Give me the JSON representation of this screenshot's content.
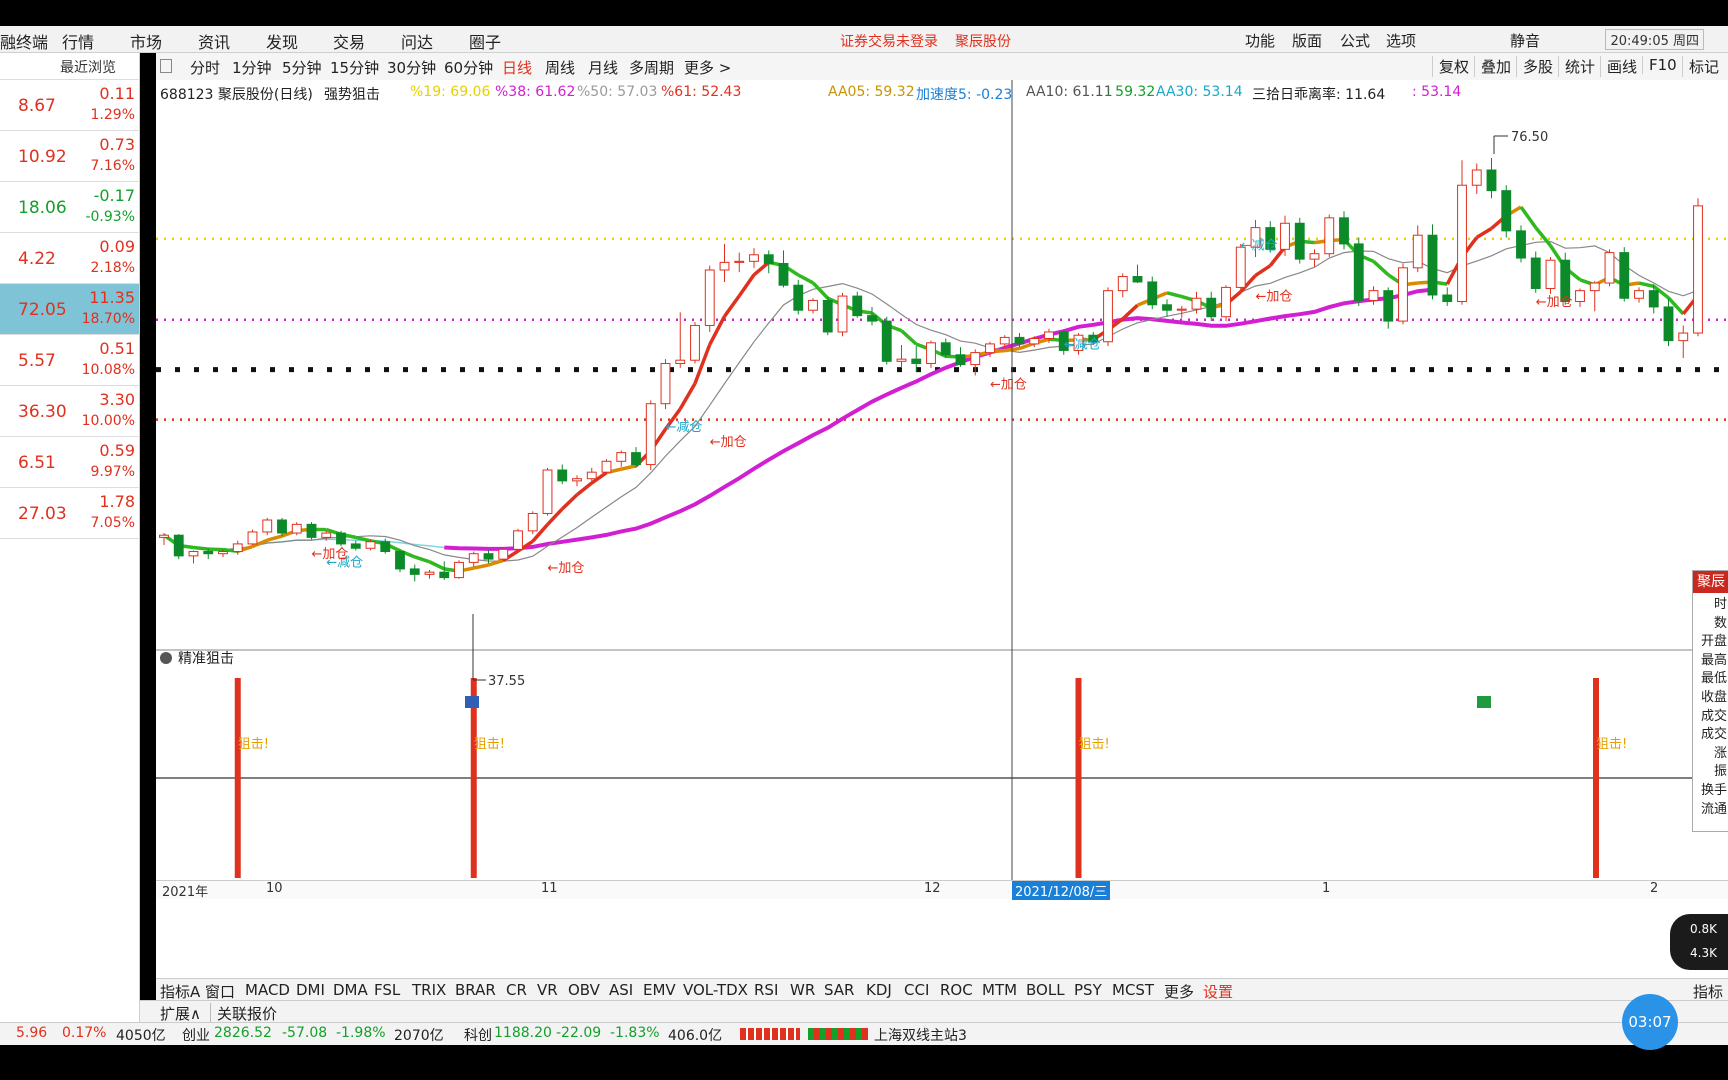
{
  "menu": {
    "items": [
      "融终端",
      "行情",
      "市场",
      "资讯",
      "发现",
      "交易",
      "问达",
      "圈子"
    ],
    "notice": "证券交易未登录",
    "stock_link": "聚辰股份",
    "right_items": [
      "功能",
      "版面",
      "公式",
      "选项",
      "",
      "静音"
    ],
    "time": "20:49:05 周四"
  },
  "left_panel": {
    "header": "最近浏览",
    "rows": [
      {
        "price": "8.67",
        "change": "0.11",
        "pct": "1.29%",
        "dir": "up"
      },
      {
        "price": "10.92",
        "change": "0.73",
        "pct": "7.16%",
        "dir": "up"
      },
      {
        "price": "18.06",
        "change": "-0.17",
        "pct": "-0.93%",
        "dir": "down"
      },
      {
        "price": "4.22",
        "change": "0.09",
        "pct": "2.18%",
        "dir": "up"
      },
      {
        "price": "72.05",
        "change": "11.35",
        "pct": "18.70%",
        "dir": "up",
        "selected": true
      },
      {
        "price": "5.57",
        "change": "0.51",
        "pct": "10.08%",
        "dir": "up"
      },
      {
        "price": "36.30",
        "change": "3.30",
        "pct": "10.00%",
        "dir": "up"
      },
      {
        "price": "6.51",
        "change": "0.59",
        "pct": "9.97%",
        "dir": "up"
      },
      {
        "price": "27.03",
        "change": "1.78",
        "pct": "7.05%",
        "dir": "up"
      }
    ]
  },
  "toolbar": {
    "periods": [
      "分时",
      "1分钟",
      "5分钟",
      "15分钟",
      "30分钟",
      "60分钟",
      "日线",
      "周线",
      "月线",
      "多周期",
      "更多 >"
    ],
    "active_period": "日线",
    "right_buttons": [
      "复权",
      "叠加",
      "多股",
      "统计",
      "画线",
      "F10",
      "标记"
    ]
  },
  "chart_header": {
    "title": "688123 聚辰股份(日线)",
    "formula": "强势狙击",
    "p19": "%19: 69.06",
    "p38": "%38: 61.62",
    "p50": "%50: 57.03",
    "p61": "%61: 52.43",
    "aa05": "AA05: 59.32",
    "accel": "加速度5: -0.23",
    "aa10": "AA10: 61.11",
    "v2": ": 59.32",
    "aa30": "AA30: 53.14",
    "dev": "三拾日乖离率: 11.64",
    "dev2": ": 53.14",
    "high_label": "76.50",
    "low_label": "37.55"
  },
  "signals": {
    "add": "加仓",
    "reduce": "减仓",
    "snipe": "狙击!"
  },
  "lower_panel": {
    "title": "精准狙击"
  },
  "date_axis": {
    "year": "2021年",
    "m10": "10",
    "m11": "11",
    "m12": "12",
    "m1": "1",
    "m2": "2",
    "cursor": "2021/12/08/三"
  },
  "tabs": [
    "指标A",
    "窗口",
    "MACD",
    "DMI",
    "DMA",
    "FSL",
    "TRIX",
    "BRAR",
    "CR",
    "VR",
    "OBV",
    "ASI",
    "EMV",
    "VOL-TDX",
    "RSI",
    "WR",
    "SAR",
    "KDJ",
    "CCI",
    "ROC",
    "MTM",
    "BOLL",
    "PSY",
    "MCST",
    "更多",
    "设置"
  ],
  "tab_right": "指标B",
  "expand": {
    "label": "扩展∧",
    "link": "关联报价"
  },
  "status": {
    "a": "5.96",
    "b": "0.17%",
    "c": "4050亿",
    "cy_label": "创业",
    "cy": "2826.52",
    "cy_chg": "-57.08",
    "cy_pct": "-1.98%",
    "cy_amt": "2070亿",
    "kc_label": "科创",
    "kc": "1188.20",
    "kc_chg": "-22.09",
    "kc_pct": "-1.83%",
    "kc_amt": "406.0亿",
    "server": "上海双线主站3"
  },
  "right_panel": {
    "title": "聚辰",
    "items": [
      "时",
      "数",
      "开盘",
      "最高",
      "最低",
      "收盘",
      "成交",
      "成交",
      "涨",
      "振",
      "换手",
      "流通"
    ]
  },
  "timer": "03:07",
  "speed": {
    "up": "0.8K",
    "down": "4.3K"
  },
  "chart_data": {
    "type": "candlestick",
    "title": "688123 聚辰股份(日线)",
    "period": "2021-09 to 2022-02",
    "high": 76.5,
    "low": 37.55,
    "hlines": [
      69.06,
      61.62,
      57.03,
      52.43
    ],
    "candles": [
      [
        41.6,
        42.0,
        40.9,
        41.8
      ],
      [
        41.8,
        41.9,
        39.6,
        39.9
      ],
      [
        39.9,
        40.4,
        39.2,
        40.3
      ],
      [
        40.3,
        40.6,
        39.6,
        40.1
      ],
      [
        40.1,
        40.5,
        39.8,
        40.3
      ],
      [
        40.3,
        41.3,
        40.0,
        41.0
      ],
      [
        41.0,
        42.3,
        40.9,
        42.1
      ],
      [
        42.1,
        43.4,
        41.8,
        43.2
      ],
      [
        43.2,
        43.4,
        41.7,
        42.0
      ],
      [
        42.0,
        43.0,
        41.8,
        42.8
      ],
      [
        42.8,
        43.0,
        41.4,
        41.6
      ],
      [
        41.6,
        42.2,
        41.3,
        42.0
      ],
      [
        42.0,
        42.2,
        40.8,
        41.0
      ],
      [
        41.0,
        41.3,
        40.4,
        40.6
      ],
      [
        40.6,
        41.4,
        40.4,
        41.2
      ],
      [
        41.2,
        41.5,
        40.1,
        40.3
      ],
      [
        40.3,
        40.5,
        38.4,
        38.7
      ],
      [
        38.7,
        39.1,
        37.55,
        38.2
      ],
      [
        38.2,
        38.6,
        37.8,
        38.4
      ],
      [
        38.4,
        39.4,
        37.7,
        37.9
      ],
      [
        37.9,
        39.5,
        37.8,
        39.3
      ],
      [
        39.3,
        40.3,
        38.9,
        40.1
      ],
      [
        40.1,
        40.4,
        39.2,
        39.6
      ],
      [
        39.6,
        40.7,
        39.4,
        40.5
      ],
      [
        40.5,
        42.4,
        40.3,
        42.2
      ],
      [
        42.2,
        44.0,
        41.9,
        43.8
      ],
      [
        43.8,
        48.0,
        43.6,
        47.8
      ],
      [
        47.8,
        48.3,
        46.5,
        46.8
      ],
      [
        46.8,
        47.3,
        46.3,
        47.0
      ],
      [
        47.0,
        48.0,
        46.6,
        47.6
      ],
      [
        47.6,
        48.8,
        47.4,
        48.6
      ],
      [
        48.6,
        49.6,
        48.1,
        49.4
      ],
      [
        49.4,
        49.9,
        48.0,
        48.3
      ],
      [
        48.3,
        54.2,
        47.8,
        53.9
      ],
      [
        53.9,
        58.0,
        53.4,
        57.6
      ],
      [
        57.6,
        62.3,
        57.2,
        57.9
      ],
      [
        57.9,
        61.4,
        57.6,
        61.1
      ],
      [
        61.1,
        66.6,
        60.5,
        66.2
      ],
      [
        66.2,
        68.6,
        65.1,
        66.9
      ],
      [
        66.9,
        67.8,
        66.0,
        67.0
      ],
      [
        67.0,
        68.2,
        66.4,
        67.6
      ],
      [
        67.6,
        68.0,
        65.9,
        66.8
      ],
      [
        66.8,
        68.0,
        64.6,
        64.8
      ],
      [
        64.8,
        65.3,
        62.1,
        62.5
      ],
      [
        62.5,
        63.6,
        62.2,
        63.4
      ],
      [
        63.4,
        63.7,
        60.2,
        60.5
      ],
      [
        60.5,
        64.1,
        60.1,
        63.8
      ],
      [
        63.8,
        64.2,
        61.8,
        62.0
      ],
      [
        62.0,
        62.8,
        61.1,
        61.5
      ],
      [
        61.5,
        61.9,
        57.5,
        57.8
      ],
      [
        57.8,
        59.3,
        57.2,
        58.0
      ],
      [
        58.0,
        59.2,
        56.8,
        57.6
      ],
      [
        57.6,
        59.7,
        57.2,
        59.5
      ],
      [
        59.5,
        59.9,
        58.1,
        58.4
      ],
      [
        58.4,
        59.1,
        57.3,
        57.5
      ],
      [
        57.5,
        58.9,
        56.5,
        58.6
      ],
      [
        58.6,
        59.6,
        58.2,
        59.4
      ],
      [
        59.4,
        60.2,
        59.0,
        60.0
      ],
      [
        60.0,
        60.4,
        59.1,
        59.4
      ],
      [
        59.4,
        60.1,
        59.1,
        59.9
      ],
      [
        59.9,
        60.8,
        59.5,
        60.5
      ],
      [
        60.5,
        60.7,
        58.4,
        58.8
      ],
      [
        58.8,
        60.4,
        58.4,
        60.2
      ],
      [
        60.2,
        60.5,
        59.3,
        59.6
      ],
      [
        59.6,
        64.6,
        59.2,
        64.3
      ],
      [
        64.3,
        65.9,
        63.7,
        65.6
      ],
      [
        65.6,
        66.7,
        65.0,
        65.1
      ],
      [
        65.1,
        65.6,
        62.6,
        63.0
      ],
      [
        63.0,
        63.5,
        61.9,
        62.5
      ],
      [
        62.5,
        62.9,
        61.8,
        62.6
      ],
      [
        62.6,
        64.2,
        62.2,
        63.6
      ],
      [
        63.6,
        64.2,
        61.5,
        61.9
      ],
      [
        61.9,
        64.8,
        61.5,
        64.6
      ],
      [
        64.6,
        68.6,
        64.1,
        68.3
      ],
      [
        68.3,
        70.8,
        67.4,
        70.1
      ],
      [
        70.1,
        70.7,
        67.8,
        68.1
      ],
      [
        68.1,
        71.2,
        67.5,
        70.5
      ],
      [
        70.5,
        71.0,
        66.8,
        67.2
      ],
      [
        67.2,
        68.1,
        66.5,
        67.7
      ],
      [
        67.7,
        71.3,
        67.4,
        71.0
      ],
      [
        71.0,
        71.6,
        68.1,
        68.6
      ],
      [
        68.6,
        69.2,
        62.9,
        63.4
      ],
      [
        63.4,
        64.7,
        63.0,
        64.3
      ],
      [
        64.3,
        64.6,
        60.8,
        61.5
      ],
      [
        61.5,
        66.8,
        61.2,
        66.4
      ],
      [
        66.4,
        70.3,
        66.0,
        69.4
      ],
      [
        69.4,
        70.4,
        63.5,
        63.9
      ],
      [
        63.9,
        64.6,
        62.9,
        63.3
      ],
      [
        63.3,
        76.3,
        63.0,
        74.0
      ],
      [
        74.0,
        76.0,
        73.2,
        75.4
      ],
      [
        75.4,
        76.5,
        72.8,
        73.5
      ],
      [
        73.5,
        74.0,
        69.2,
        69.8
      ],
      [
        69.8,
        70.3,
        66.9,
        67.3
      ],
      [
        67.3,
        67.9,
        64.1,
        64.5
      ],
      [
        64.5,
        67.4,
        64.0,
        67.1
      ],
      [
        67.1,
        67.8,
        63.0,
        63.3
      ],
      [
        63.3,
        64.5,
        62.8,
        64.3
      ],
      [
        64.3,
        65.2,
        62.4,
        65.0
      ],
      [
        65.0,
        68.1,
        64.7,
        67.8
      ],
      [
        67.8,
        68.3,
        63.3,
        63.6
      ],
      [
        63.6,
        64.6,
        63.2,
        64.3
      ],
      [
        64.3,
        64.9,
        62.2,
        62.8
      ],
      [
        62.8,
        63.6,
        59.2,
        59.7
      ],
      [
        59.7,
        61.1,
        58.1,
        60.4
      ],
      [
        60.4,
        72.8,
        60.1,
        72.1
      ]
    ]
  }
}
